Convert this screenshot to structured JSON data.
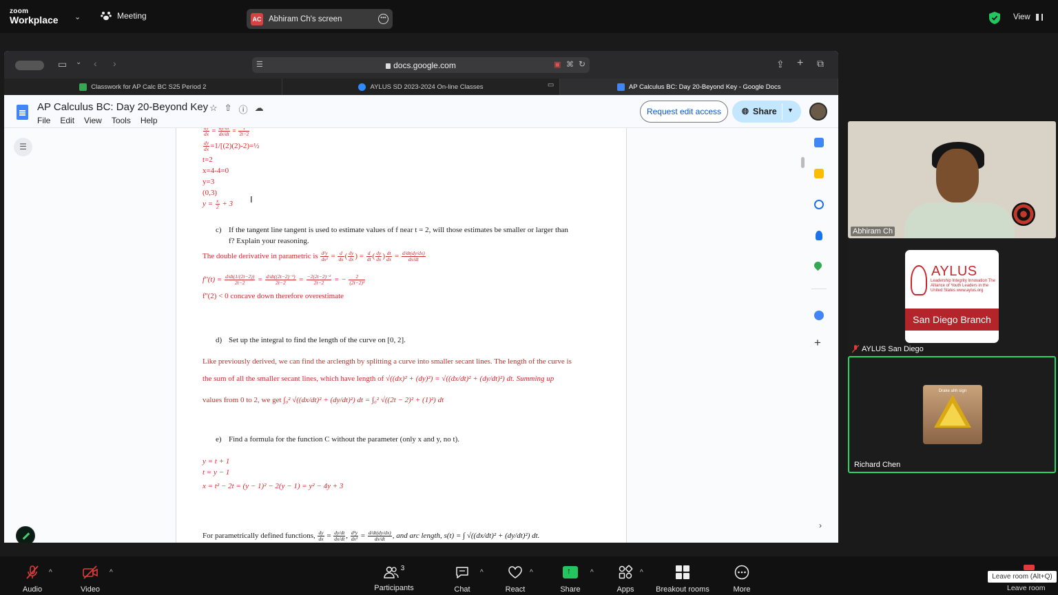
{
  "zoom": {
    "logo_small": "zoom",
    "logo_big": "Workplace",
    "meeting_label": "Meeting",
    "screen_share_initials": "AC",
    "screen_share_label": "Abhiram Ch's screen",
    "view_label": "View"
  },
  "browser": {
    "url": "docs.google.com",
    "tabs": [
      {
        "label": "Classwork for AP Calc BC S25 Period 2",
        "icon_color": "#34a853"
      },
      {
        "label": "AYLUS SD 2023-2024 On-line Classes",
        "icon_color": "#2d8cff"
      },
      {
        "label": "AP Calculus BC: Day 20-Beyond Key - Google Docs",
        "icon_color": "#4285f4"
      }
    ]
  },
  "docs": {
    "title": "AP Calculus BC: Day 20-Beyond Key",
    "menu": [
      "File",
      "Edit",
      "View",
      "Tools",
      "Help"
    ],
    "request_edit": "Request edit access",
    "share": "Share"
  },
  "doc_content": {
    "l1": "=1/[(2)(2)-2)=½",
    "l2": "t=2",
    "l3": "x=4-4=0",
    "l4": "y=3",
    "l5": "(0,3)",
    "l6a": "y =",
    "l6b": "+ 3",
    "c_label": "c)",
    "c_q1": "If the tangent line tangent is used to estimate values of f near t = 2, will those estimates be smaller or larger than",
    "c_q2": "f? Explain your reasoning.",
    "c_a1": "The double derivative in parametric is",
    "c_a2": "f''(t) =",
    "c_a3": "f''(2) < 0 concave down therefore overestimate",
    "d_label": "d)",
    "d_q": "Set up the integral to find the length of the curve on [0, 2].",
    "d_a1": "Like previously derived, we can find the arclength by splitting a curve into smaller secant lines. The length of the curve is",
    "d_a2a": "the sum of all the smaller secant lines, which have length of",
    "d_a2b": "√((dx)² + (dy)²) = √((dx/dt)² + (dy/dt)²) dt. Summing up",
    "d_a3a": "values from 0 to 2, we get",
    "d_a3b": "∫₀² √((dx/dt)² + (dy/dt)²) dt = ∫₀² √((2t − 2)² + (1)²) dt",
    "e_label": "e)",
    "e_q": "Find a formula for the function C without the parameter (only x and y, no t).",
    "e_a1": "y = t + 1",
    "e_a2": "t = y − 1",
    "e_a3": "x = t² − 2t = (y − 1)² − 2(y − 1) = y² − 4y + 3",
    "footer": "For parametrically defined functions,",
    "footer2": ", and arc length, s(t) = ∫ √((dx/dt)² + (dy/dt)²) dt."
  },
  "participants": [
    {
      "name": "Abhiram Ch"
    },
    {
      "name": "AYLUS San Diego",
      "muted": true
    },
    {
      "name": "Richard Chen",
      "active_speaker": true
    }
  ],
  "aylus_card": {
    "name": "AYLUS",
    "tagline": "Leadership Integrity Innovation The Alliance of Youth Leaders in the United States www.aylus.org",
    "branch": "San Diego Branch"
  },
  "richard_image_caption": "Drake ahh sign",
  "controls": {
    "audio": "Audio",
    "video": "Video",
    "participants": "Participants",
    "participants_count": "3",
    "chat": "Chat",
    "react": "React",
    "share": "Share",
    "apps": "Apps",
    "breakout": "Breakout rooms",
    "more": "More",
    "leave_tooltip": "Leave room (Alt+Q)",
    "leave": "Leave room"
  },
  "colors": {
    "accent_red": "#d6272b",
    "share_green": "#22c55e",
    "speaker_border": "#23d96b",
    "docs_blue": "#4285f4"
  }
}
